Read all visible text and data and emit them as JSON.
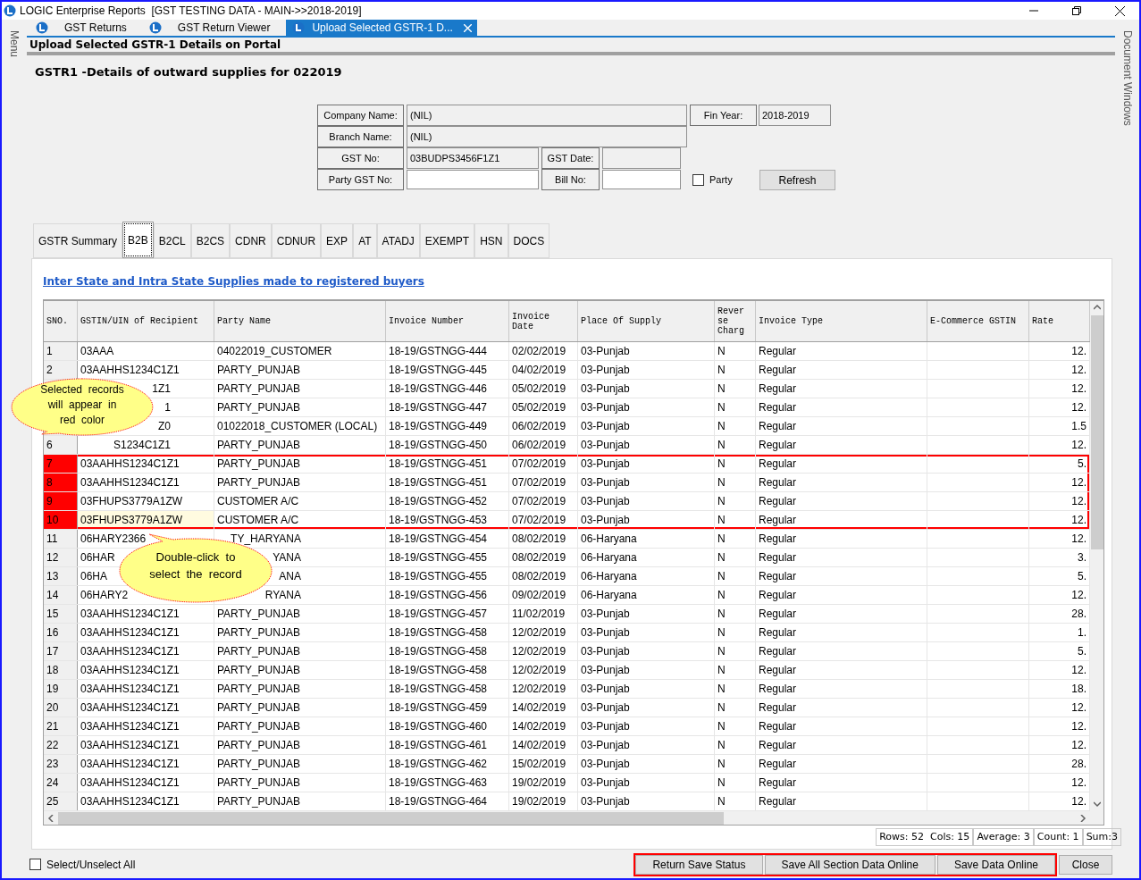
{
  "window": {
    "title": "LOGIC Enterprise Reports  [GST TESTING DATA - MAIN->>2018-2019]"
  },
  "side_tabs": {
    "left": "Menu",
    "right": "Document Windows"
  },
  "doc_tabs": [
    {
      "label": "GST Returns",
      "selected": false,
      "closable": false
    },
    {
      "label": "GST Return Viewer",
      "selected": false,
      "closable": false
    },
    {
      "label": "Upload Selected GSTR-1 D...",
      "selected": true,
      "closable": true
    }
  ],
  "page_title": "Upload Selected GSTR-1 Details on Portal",
  "heading": "GSTR1 -Details of outward supplies for 022019",
  "form": {
    "company_name": {
      "label": "Company Name:",
      "value": "(NIL)"
    },
    "fin_year": {
      "label": "Fin Year:",
      "value": "2018-2019"
    },
    "branch_name": {
      "label": "Branch Name:",
      "value": "(NIL)"
    },
    "gst_no": {
      "label": "GST No:",
      "value": "03BUDPS3456F1Z1"
    },
    "gst_date": {
      "label": "GST Date:"
    },
    "party_gst_no": {
      "label": "Party GST No:"
    },
    "bill_no": {
      "label": "Bill No:"
    },
    "party_checkbox": {
      "label": "Party",
      "checked": false
    },
    "refresh_button": "Refresh"
  },
  "section_tabs": [
    {
      "label": "GSTR Summary",
      "selected": false
    },
    {
      "label": "B2B",
      "selected": true
    },
    {
      "label": "B2CL",
      "selected": false
    },
    {
      "label": "B2CS",
      "selected": false
    },
    {
      "label": "CDNR",
      "selected": false
    },
    {
      "label": "CDNUR",
      "selected": false
    },
    {
      "label": "EXP",
      "selected": false
    },
    {
      "label": "AT",
      "selected": false
    },
    {
      "label": "ATADJ",
      "selected": false
    },
    {
      "label": "EXEMPT",
      "selected": false
    },
    {
      "label": "HSN",
      "selected": false
    },
    {
      "label": "DOCS",
      "selected": false
    }
  ],
  "section_link": "Inter State and Intra State Supplies made to registered buyers",
  "table": {
    "columns": [
      "SNO.",
      "GSTIN/UIN of Recipient",
      "Party Name",
      "Invoice Number",
      "Invoice Date",
      "Place Of Supply",
      "Reverse Charg",
      "Invoice Type",
      "E-Commerce GSTIN",
      "Rate"
    ],
    "rows": [
      {
        "selected": false,
        "current": false,
        "cells": [
          "1",
          "03AAA",
          "04022019_CUSTOMER",
          "18-19/GSTNGG-444",
          "02/02/2019",
          "03-Punjab",
          "N",
          "Regular",
          "",
          "12."
        ]
      },
      {
        "selected": false,
        "current": false,
        "cells": [
          "2",
          "03AAHHS1234C1Z1",
          "PARTY_PUNJAB",
          "18-19/GSTNGG-445",
          "04/02/2019",
          "03-Punjab",
          "N",
          "Regular",
          "",
          "12."
        ]
      },
      {
        "selected": false,
        "current": false,
        "cells": [
          "",
          {
            "text": "1Z1",
            "kind": "tail"
          },
          "PARTY_PUNJAB",
          "18-19/GSTNGG-446",
          "05/02/2019",
          "03-Punjab",
          "N",
          "Regular",
          "",
          "12."
        ]
      },
      {
        "selected": false,
        "current": false,
        "cells": [
          "",
          {
            "text": "1",
            "kind": "tail"
          },
          "PARTY_PUNJAB",
          "18-19/GSTNGG-447",
          "05/02/2019",
          "03-Punjab",
          "N",
          "Regular",
          "",
          "12."
        ]
      },
      {
        "selected": false,
        "current": false,
        "cells": [
          "",
          {
            "text": "Z0",
            "kind": "tail"
          },
          "01022018_CUSTOMER (LOCAL)",
          "18-19/GSTNGG-449",
          "06/02/2019",
          "03-Punjab",
          "N",
          "Regular",
          "",
          "1.5"
        ]
      },
      {
        "selected": false,
        "current": false,
        "cells": [
          "6",
          {
            "text": "S1234C1Z1",
            "kind": "tail"
          },
          "PARTY_PUNJAB",
          "18-19/GSTNGG-450",
          "06/02/2019",
          "03-Punjab",
          "N",
          "Regular",
          "",
          "12."
        ]
      },
      {
        "selected": true,
        "current": false,
        "cells": [
          "7",
          "03AAHHS1234C1Z1",
          "PARTY_PUNJAB",
          "18-19/GSTNGG-451",
          "07/02/2019",
          "03-Punjab",
          "N",
          "Regular",
          "",
          "5."
        ]
      },
      {
        "selected": true,
        "current": false,
        "cells": [
          "8",
          "03AAHHS1234C1Z1",
          "PARTY_PUNJAB",
          "18-19/GSTNGG-451",
          "07/02/2019",
          "03-Punjab",
          "N",
          "Regular",
          "",
          "12."
        ]
      },
      {
        "selected": true,
        "current": false,
        "cells": [
          "9",
          "03FHUPS3779A1ZW",
          "CUSTOMER A/C",
          "18-19/GSTNGG-452",
          "07/02/2019",
          "03-Punjab",
          "N",
          "Regular",
          "",
          "12."
        ]
      },
      {
        "selected": true,
        "current": true,
        "cells": [
          "10",
          "03FHUPS3779A1ZW",
          "CUSTOMER A/C",
          "18-19/GSTNGG-453",
          "07/02/2019",
          "03-Punjab",
          "N",
          "Regular",
          "",
          "12."
        ]
      },
      {
        "selected": false,
        "current": false,
        "cells": [
          "11",
          "06HARY2366",
          {
            "text": "TY_HARYANA",
            "kind": "tail"
          },
          "18-19/GSTNGG-454",
          "08/02/2019",
          "06-Haryana",
          "N",
          "Regular",
          "",
          "12."
        ]
      },
      {
        "selected": false,
        "current": false,
        "cells": [
          "12",
          "06HAR",
          {
            "text": "YANA",
            "kind": "tail"
          },
          "18-19/GSTNGG-455",
          "08/02/2019",
          "06-Haryana",
          "N",
          "Regular",
          "",
          "3."
        ]
      },
      {
        "selected": false,
        "current": false,
        "cells": [
          "13",
          "06HA",
          {
            "text": "ANA",
            "kind": "tail"
          },
          "18-19/GSTNGG-455",
          "08/02/2019",
          "06-Haryana",
          "N",
          "Regular",
          "",
          "5."
        ]
      },
      {
        "selected": false,
        "current": false,
        "cells": [
          "14",
          "06HARY2",
          {
            "text": "RYANA",
            "kind": "tail"
          },
          "18-19/GSTNGG-456",
          "09/02/2019",
          "06-Haryana",
          "N",
          "Regular",
          "",
          "12."
        ]
      },
      {
        "selected": false,
        "current": false,
        "cells": [
          "15",
          "03AAHHS1234C1Z1",
          "PARTY_PUNJAB",
          "18-19/GSTNGG-457",
          "11/02/2019",
          "03-Punjab",
          "N",
          "Regular",
          "",
          "28."
        ]
      },
      {
        "selected": false,
        "current": false,
        "cells": [
          "16",
          "03AAHHS1234C1Z1",
          "PARTY_PUNJAB",
          "18-19/GSTNGG-458",
          "12/02/2019",
          "03-Punjab",
          "N",
          "Regular",
          "",
          "1."
        ]
      },
      {
        "selected": false,
        "current": false,
        "cells": [
          "17",
          "03AAHHS1234C1Z1",
          "PARTY_PUNJAB",
          "18-19/GSTNGG-458",
          "12/02/2019",
          "03-Punjab",
          "N",
          "Regular",
          "",
          "5."
        ]
      },
      {
        "selected": false,
        "current": false,
        "cells": [
          "18",
          "03AAHHS1234C1Z1",
          "PARTY_PUNJAB",
          "18-19/GSTNGG-458",
          "12/02/2019",
          "03-Punjab",
          "N",
          "Regular",
          "",
          "12."
        ]
      },
      {
        "selected": false,
        "current": false,
        "cells": [
          "19",
          "03AAHHS1234C1Z1",
          "PARTY_PUNJAB",
          "18-19/GSTNGG-458",
          "12/02/2019",
          "03-Punjab",
          "N",
          "Regular",
          "",
          "18."
        ]
      },
      {
        "selected": false,
        "current": false,
        "cells": [
          "20",
          "03AAHHS1234C1Z1",
          "PARTY_PUNJAB",
          "18-19/GSTNGG-459",
          "14/02/2019",
          "03-Punjab",
          "N",
          "Regular",
          "",
          "12."
        ]
      },
      {
        "selected": false,
        "current": false,
        "cells": [
          "21",
          "03AAHHS1234C1Z1",
          "PARTY_PUNJAB",
          "18-19/GSTNGG-460",
          "14/02/2019",
          "03-Punjab",
          "N",
          "Regular",
          "",
          "12."
        ]
      },
      {
        "selected": false,
        "current": false,
        "cells": [
          "22",
          "03AAHHS1234C1Z1",
          "PARTY_PUNJAB",
          "18-19/GSTNGG-461",
          "14/02/2019",
          "03-Punjab",
          "N",
          "Regular",
          "",
          "12."
        ]
      },
      {
        "selected": false,
        "current": false,
        "cells": [
          "23",
          "03AAHHS1234C1Z1",
          "PARTY_PUNJAB",
          "18-19/GSTNGG-462",
          "15/02/2019",
          "03-Punjab",
          "N",
          "Regular",
          "",
          "28."
        ]
      },
      {
        "selected": false,
        "current": false,
        "cells": [
          "24",
          "03AAHHS1234C1Z1",
          "PARTY_PUNJAB",
          "18-19/GSTNGG-463",
          "19/02/2019",
          "03-Punjab",
          "N",
          "Regular",
          "",
          "12."
        ]
      },
      {
        "selected": false,
        "current": false,
        "cells": [
          "25",
          "03AAHHS1234C1Z1",
          "PARTY_PUNJAB",
          "18-19/GSTNGG-464",
          "19/02/2019",
          "03-Punjab",
          "N",
          "Regular",
          "",
          "12."
        ]
      }
    ]
  },
  "status_bar": [
    "Rows: 52  Cols: 15",
    "Average: 3",
    "Count: 1",
    "Sum:3"
  ],
  "select_all": {
    "label": "Select/Unselect All",
    "checked": false
  },
  "buttons": [
    {
      "label": "Return Save Status",
      "highlighted": true
    },
    {
      "label": "Save All Section Data Online",
      "highlighted": true
    },
    {
      "label": "Save Data Online",
      "highlighted": true
    },
    {
      "label": "Close",
      "highlighted": false
    }
  ],
  "callouts": [
    {
      "lines": [
        "Selected  records",
        "will  appear  in",
        "red  color"
      ]
    },
    {
      "lines": [
        "Double-click  to",
        "select  the  record"
      ]
    }
  ]
}
